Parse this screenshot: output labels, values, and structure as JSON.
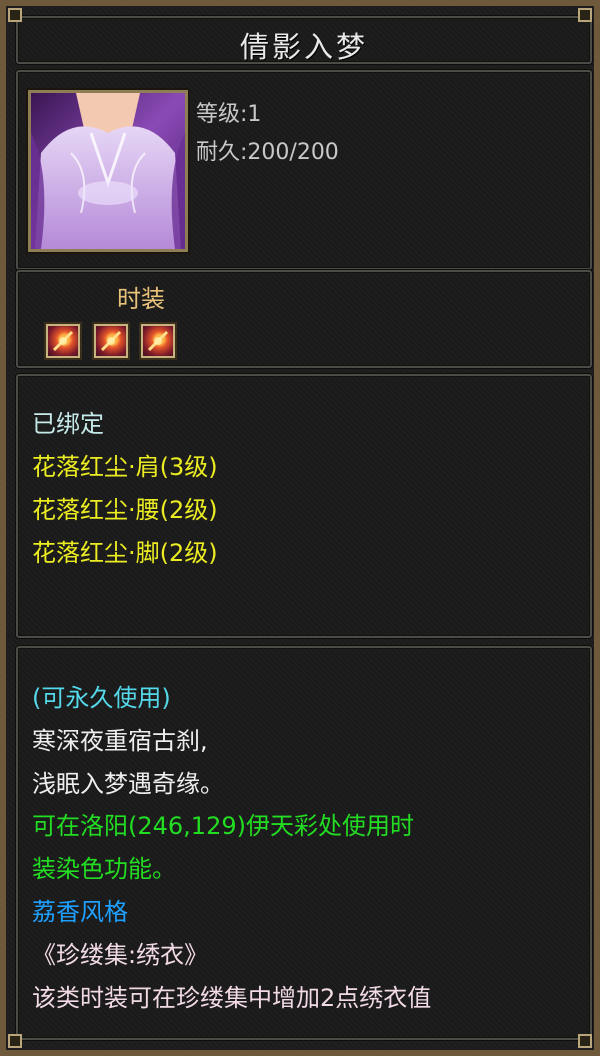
{
  "item": {
    "name": "倩影入梦",
    "level_text": "等级:1",
    "durability_text": "耐久:200/200",
    "category": "时装",
    "gem_slots": [
      "gem-icon",
      "gem-icon",
      "gem-icon"
    ]
  },
  "binding": {
    "bound_text": "已绑定",
    "set_attributes": [
      "花落红尘·肩(3级)",
      "花落红尘·腰(2级)",
      "花落红尘·脚(2级)"
    ]
  },
  "description": {
    "usage": "(可永久使用)",
    "poem_line1": "寒深夜重宿古刹,",
    "poem_line2": "浅眠入梦遇奇缘。",
    "dye_line1": "可在洛阳(246,129)伊天彩处使用时",
    "dye_line2": "装染色功能。",
    "style": "荔香风格",
    "collection": "《珍缕集:绣衣》",
    "collection_note": "该类时装可在珍缕集中增加2点绣衣值"
  },
  "colors": {
    "frame": "#6e5a3a",
    "cyan": "#55d9ea",
    "yellow": "#ecec22",
    "green": "#22dd22",
    "blue": "#1ea0ff"
  }
}
